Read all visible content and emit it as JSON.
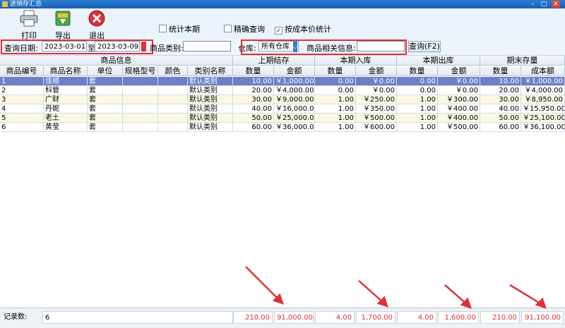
{
  "window": {
    "title": "进销存汇总"
  },
  "toolbar": {
    "print_label": "打印",
    "export_label": "导出",
    "exit_label": "退出"
  },
  "options": {
    "stat_period": {
      "label": "统计本期",
      "checked": false
    },
    "exact_query": {
      "label": "精确查询",
      "checked": false
    },
    "cost_price": {
      "label": "按成本价统计",
      "checked": true
    }
  },
  "filter": {
    "date_label": "查询日期:",
    "date_from": "2023-03-01",
    "to_label": "至",
    "date_to": "2023-03-09",
    "category_label": "商品类别:",
    "category_value": "",
    "warehouse_label": "仓库:",
    "warehouse_value": "所有仓库",
    "info_label": "商品相关信息:",
    "info_value": "",
    "query_button": "查询(F2)"
  },
  "table": {
    "groups": [
      "商品信息",
      "上期结存",
      "本期入库",
      "本期出库",
      "期末存量"
    ],
    "columns": [
      "商品编号",
      "商品名称",
      "单位",
      "规格型号",
      "颜色",
      "类别名称",
      "数量",
      "金额",
      "数量",
      "金额",
      "数量",
      "金额",
      "数量",
      "成本额"
    ],
    "rows": [
      [
        "1",
        "佳顺",
        "套",
        "",
        "",
        "默认类别",
        "10.00",
        "￥1,000.00",
        "0.00",
        "￥0.00",
        "0.00",
        "￥0.00",
        "10.00",
        "￥1,000.00"
      ],
      [
        "2",
        "科管",
        "套",
        "",
        "",
        "默认类别",
        "20.00",
        "￥4,000.00",
        "0.00",
        "￥0.00",
        "0.00",
        "￥0.00",
        "20.00",
        "￥4,000.00"
      ],
      [
        "3",
        "广财",
        "套",
        "",
        "",
        "默认类别",
        "30.00",
        "￥9,000.00",
        "1.00",
        "￥250.00",
        "1.00",
        "￥300.00",
        "30.00",
        "￥8,950.00"
      ],
      [
        "4",
        "丹妮",
        "套",
        "",
        "",
        "默认类别",
        "40.00",
        "￥16,000.00",
        "1.00",
        "￥350.00",
        "1.00",
        "￥400.00",
        "40.00",
        "￥15,950.00"
      ],
      [
        "5",
        "老土",
        "套",
        "",
        "",
        "默认类别",
        "50.00",
        "￥25,000.00",
        "1.00",
        "￥500.00",
        "1.00",
        "￥400.00",
        "50.00",
        "￥25,100.00"
      ],
      [
        "6",
        "黄莹",
        "套",
        "",
        "",
        "默认类别",
        "60.00",
        "￥36,000.00",
        "1.00",
        "￥600.00",
        "1.00",
        "￥500.00",
        "60.00",
        "￥36,100.00"
      ]
    ]
  },
  "footer": {
    "count_label": "记录数:",
    "count_value": "6",
    "totals": [
      "210.00",
      "91,000.00",
      "4.00",
      "1,700.00",
      "4.00",
      "1,600.00",
      "210.00",
      "91,100.00"
    ]
  },
  "colors": {
    "highlight": "#e0303a",
    "selected_row": "#6e7fc8"
  }
}
